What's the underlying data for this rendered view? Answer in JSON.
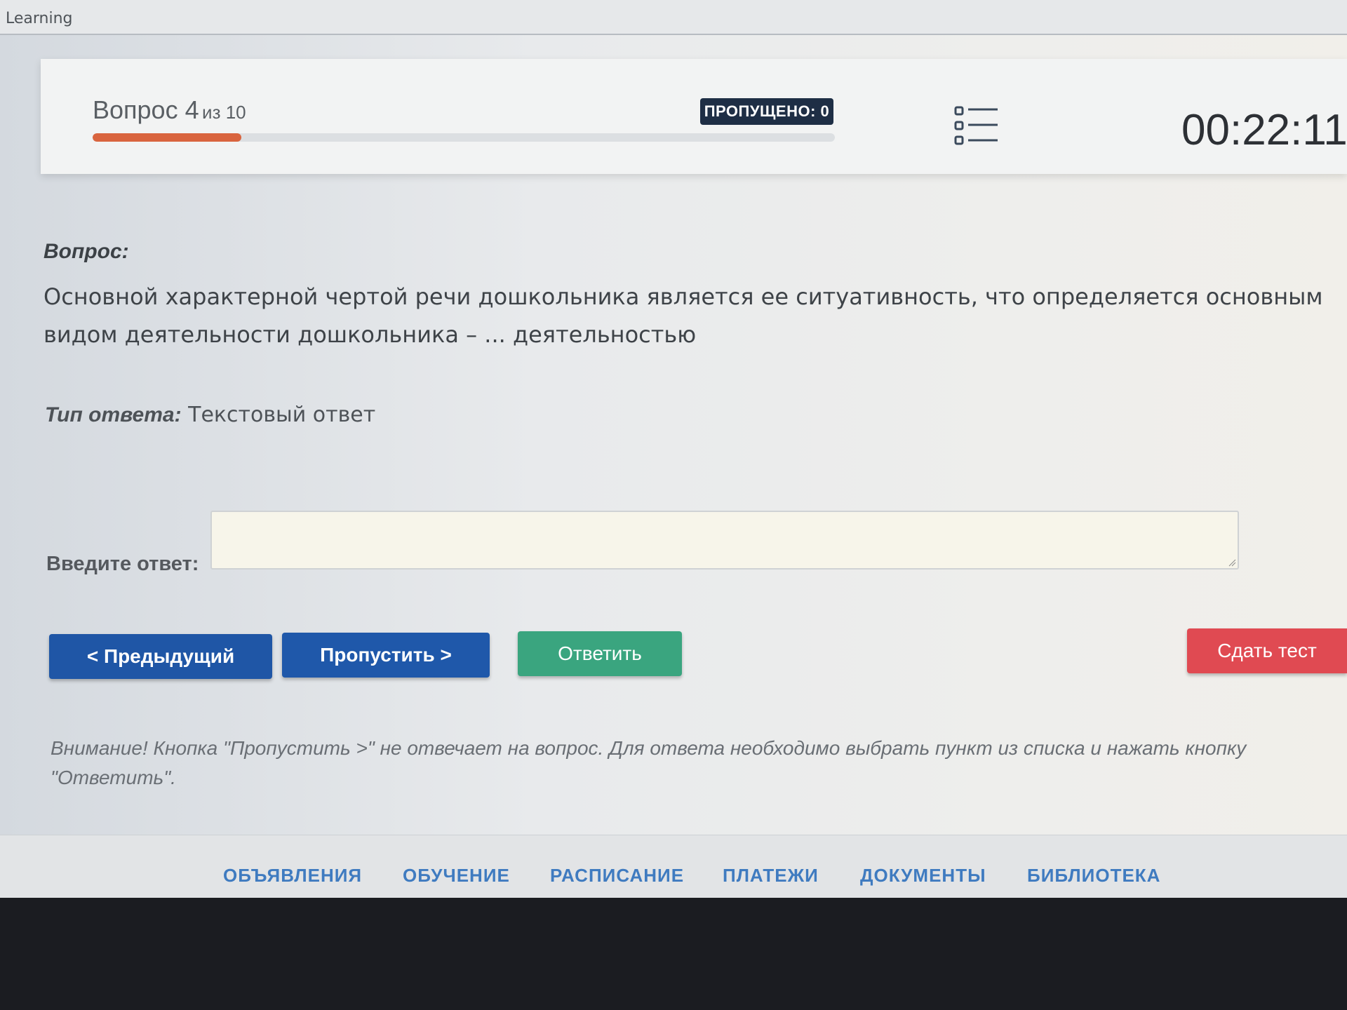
{
  "topbar": {
    "title": "Learning"
  },
  "header": {
    "question_word": "Вопрос 4",
    "question_of": "из 10",
    "progress_fraction": 0.2,
    "skipped_badge": "ПРОПУЩЕНО: 0",
    "list_icon": "list-icon",
    "timer": "00:22:11"
  },
  "question": {
    "label": "Вопрос:",
    "text": "Основной характерной чертой речи дошкольника является ее ситуативность, что определяется основным видом деятельности дошкольника – ... деятельностью"
  },
  "answer_type": {
    "label": "Тип ответа:",
    "value": "Текстовый ответ"
  },
  "answer": {
    "label": "Введите ответ:",
    "value": ""
  },
  "buttons": {
    "prev": "< Предыдущий",
    "skip": "Пропустить >",
    "answer": "Ответить",
    "submit": "Сдать тест"
  },
  "warning": "Внимание! Кнопка \"Пропустить >\" не отвечает на вопрос. Для ответа необходимо выбрать пункт из списка и нажать кнопку \"Ответить\".",
  "nav": [
    {
      "label": "ОБЪЯВЛЕНИЯ"
    },
    {
      "label": "ОБУЧЕНИЕ"
    },
    {
      "label": "РАСПИСАНИЕ"
    },
    {
      "label": "ПЛАТЕЖИ"
    },
    {
      "label": "ДОКУМЕНТЫ"
    },
    {
      "label": "БИБЛИОТЕКА"
    }
  ],
  "colors": {
    "progress": "#d9643e",
    "primary_button": "#1f56a6",
    "answer_button": "#3aa57f",
    "submit_button": "#e04a52",
    "nav_link": "#3f7bc0"
  }
}
